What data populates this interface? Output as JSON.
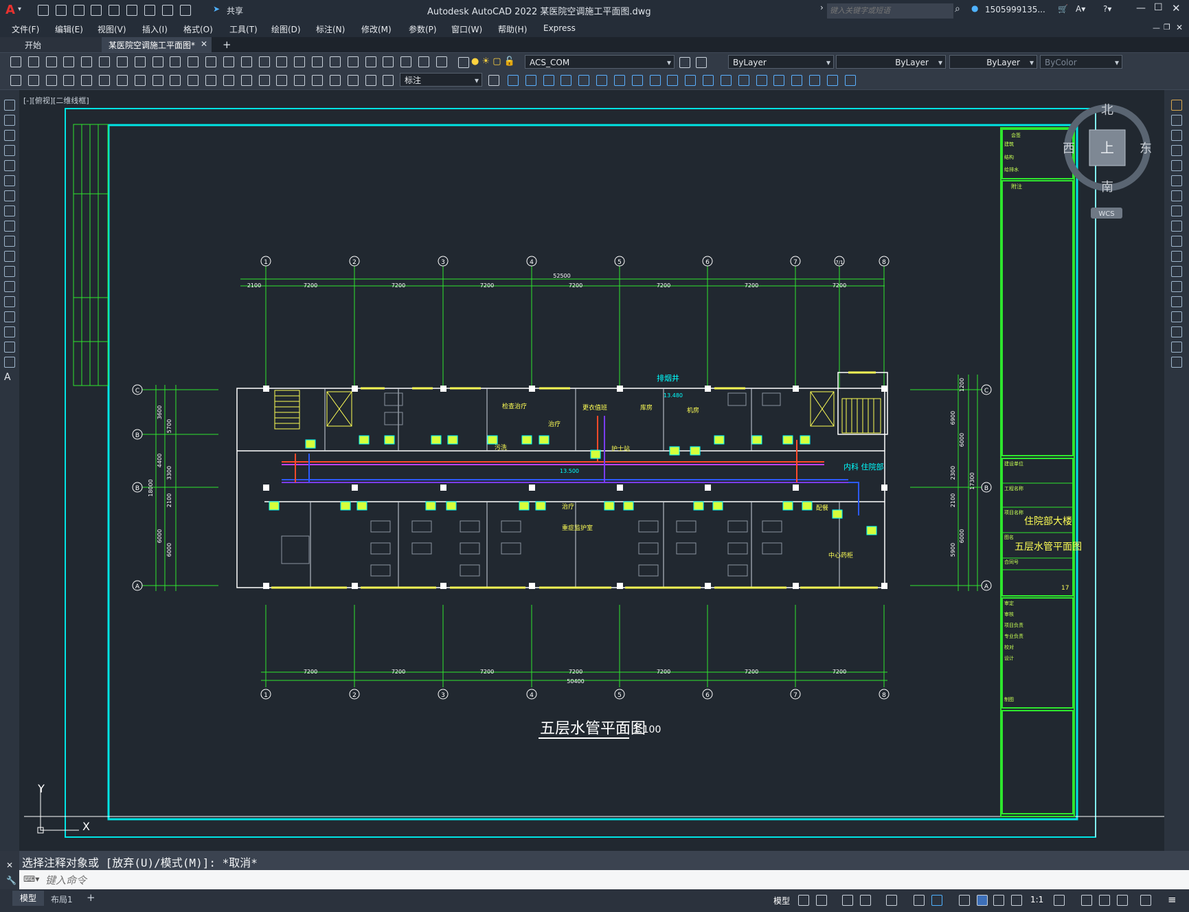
{
  "app": {
    "title_center": "Autodesk AutoCAD 2022    某医院空调施工平面图.dwg",
    "search_placeholder": "键入关键字或短语",
    "user": "1505999135...",
    "share_label": "共享"
  },
  "menu": [
    "文件(F)",
    "编辑(E)",
    "视图(V)",
    "插入(I)",
    "格式(O)",
    "工具(T)",
    "绘图(D)",
    "标注(N)",
    "修改(M)",
    "参数(P)",
    "窗口(W)",
    "帮助(H)",
    "Express"
  ],
  "tabs": {
    "start": "开始",
    "active": "某医院空调施工平面图*",
    "add": "+"
  },
  "properties": {
    "layer": "ACS_COM",
    "color": "ByLayer",
    "linetype": "ByLayer",
    "lineweight": "ByLayer",
    "plotstyle": "ByColor",
    "dimstyle": "标注"
  },
  "viewport_label": "[-][俯视][二维线框]",
  "viewcube": {
    "north": "北",
    "south": "南",
    "east": "东",
    "west": "西",
    "top": "上",
    "wcs": "WCS"
  },
  "ucs": {
    "x": "X",
    "y": "Y"
  },
  "drawing": {
    "title": "五层水管平面图",
    "scale": "1:100",
    "top_axis": [
      "1",
      "2",
      "3",
      "4",
      "5",
      "6",
      "7",
      "7/1",
      "8"
    ],
    "bottom_axis": [
      "1",
      "2",
      "3",
      "4",
      "5",
      "6",
      "7",
      "8"
    ],
    "left_axis": [
      "C",
      "B",
      "B",
      "A"
    ],
    "top_total": "52500",
    "top_dims": [
      "2100",
      "7200",
      "7200",
      "7200",
      "7200",
      "7200",
      "7200",
      "7200"
    ],
    "bottom_total": "50400",
    "bottom_dims": [
      "7200",
      "7200",
      "7200",
      "7200",
      "7200",
      "7200",
      "7200"
    ],
    "left_dims": [
      "3600",
      "5700",
      "4400",
      "3300",
      "2100",
      "6000",
      "6000",
      "18000"
    ],
    "right_dims": [
      "1200",
      "6900",
      "6000",
      "2300",
      "2100",
      "6000",
      "5900",
      "17300"
    ],
    "room_labels": [
      "排烟井",
      "13.480",
      "13.500",
      "更衣值班",
      "治疗",
      "护士站",
      "内科 住院部",
      "重症监护室",
      "中心药柜",
      "检查治疗",
      "污洗",
      "库房",
      "配餐",
      "治疗",
      "机房"
    ],
    "title_block": {
      "company": "住院部大楼",
      "drawing_name": "五层水管平面图",
      "sheet_no": "17",
      "labels": [
        "会签",
        "建筑",
        "结构",
        "给排水",
        "附注",
        "建设单位",
        "工程名称",
        "项目名称",
        "图名",
        "合同号",
        "审定",
        "审核",
        "项目负责",
        "专业负责",
        "校对",
        "设计",
        "制图"
      ]
    }
  },
  "command": {
    "history": "选择注释对象或 [放弃(U)/模式(M)]: *取消*",
    "input_placeholder": "键入命令"
  },
  "status": {
    "model_tab": "模型",
    "layout_tab": "布局1",
    "model_btn": "模型",
    "scale": "1:1"
  }
}
